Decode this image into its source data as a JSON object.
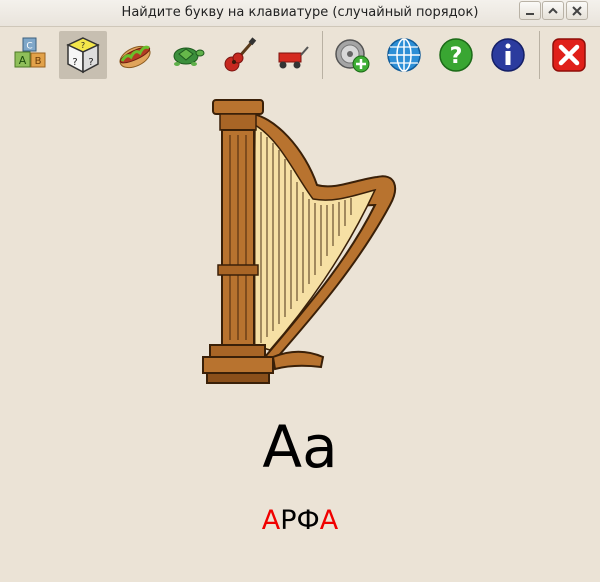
{
  "window": {
    "title": "Найдите букву на клавиатуре (случайный порядок)"
  },
  "toolbar": {
    "items": [
      {
        "name": "blocks-icon",
        "active": false
      },
      {
        "name": "random-dice-icon",
        "active": true
      },
      {
        "name": "hotdog-icon",
        "active": false
      },
      {
        "name": "turtle-icon",
        "active": false
      },
      {
        "name": "guitar-icon",
        "active": false
      },
      {
        "name": "wagon-icon",
        "active": false
      },
      {
        "name": "add-sound-icon",
        "active": false
      },
      {
        "name": "globe-icon",
        "active": false
      },
      {
        "name": "help-icon",
        "active": false
      },
      {
        "name": "info-icon",
        "active": false
      },
      {
        "name": "exit-icon",
        "active": false
      }
    ]
  },
  "main": {
    "picture": "harp",
    "letters": "Aa",
    "word": {
      "first": "А",
      "middle": "РФ",
      "last": "А"
    }
  },
  "colors": {
    "background": "#ebe3d6",
    "highlight": "#f00000",
    "active_tool": "#c7bfb1"
  }
}
